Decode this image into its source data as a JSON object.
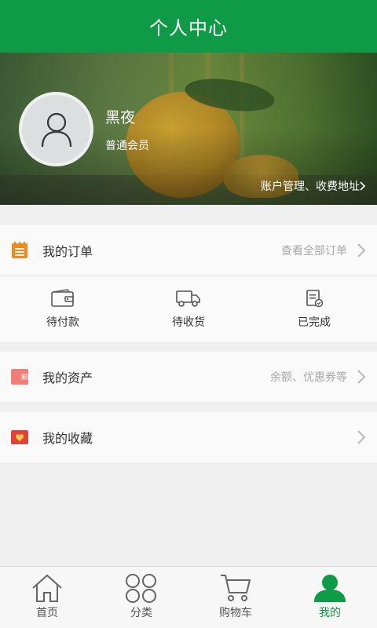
{
  "header": {
    "title": "个人中心"
  },
  "profile": {
    "name": "黑夜",
    "level": "普通会员",
    "account_link": "账户管理、收费地址"
  },
  "orders": {
    "title": "我的订单",
    "hint": "查看全部订单",
    "statuses": [
      {
        "label": "待付款",
        "icon": "wallet-icon"
      },
      {
        "label": "待收货",
        "icon": "truck-icon"
      },
      {
        "label": "已完成",
        "icon": "completed-doc-icon"
      }
    ]
  },
  "assets": {
    "title": "我的资产",
    "hint": "余额、优惠券等"
  },
  "favorites": {
    "title": "我的收藏"
  },
  "tabbar": {
    "items": [
      {
        "label": "首页",
        "icon": "home-icon"
      },
      {
        "label": "分类",
        "icon": "category-icon"
      },
      {
        "label": "购物车",
        "icon": "cart-icon"
      },
      {
        "label": "我的",
        "icon": "user-icon",
        "active": true
      }
    ]
  },
  "colors": {
    "brand": "#0f9a48",
    "order_icon": "#f08a1d",
    "assets_icon": "#f07f7a",
    "favorites_icon": "#e0413a"
  }
}
